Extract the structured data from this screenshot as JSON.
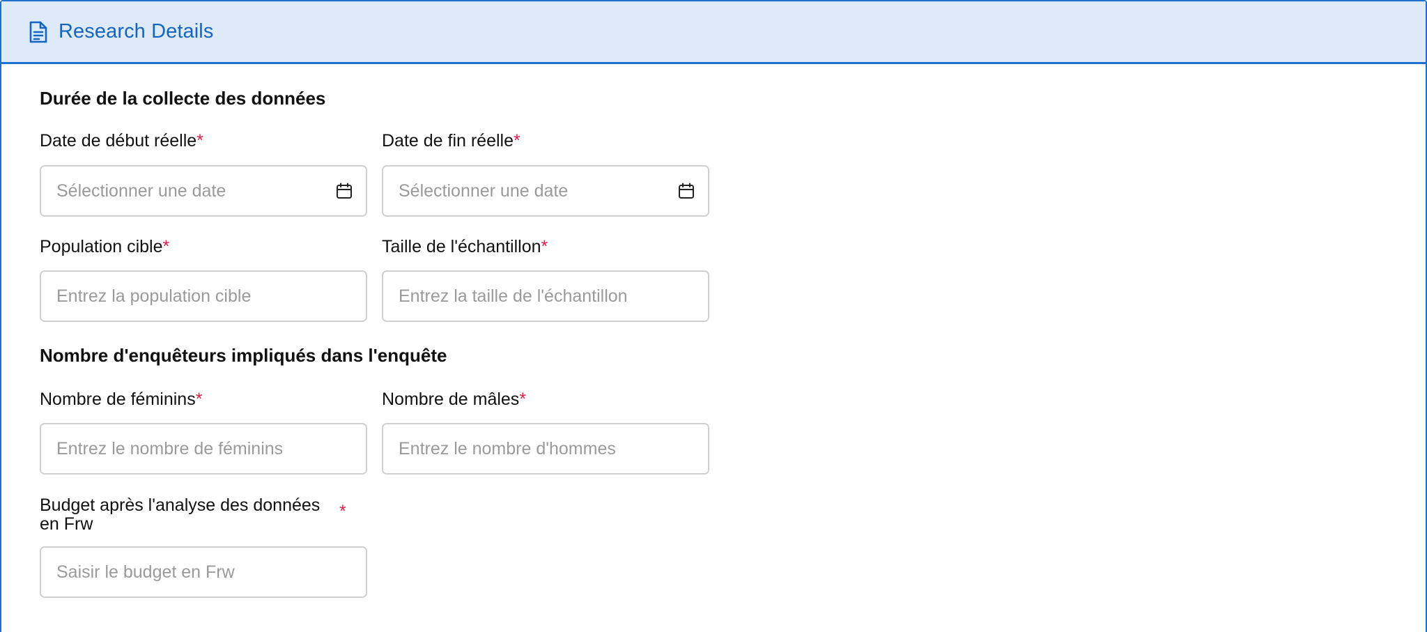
{
  "header": {
    "title": "Research Details",
    "icon": "document-icon",
    "accent_color": "#1f6fd1"
  },
  "sections": {
    "duration_title": "Durée de la collecte des données",
    "investigators_title": "Nombre d'enquêteurs impliqués dans l'enquête"
  },
  "fields": {
    "start_date": {
      "label": "Date de début réelle",
      "required": "*",
      "placeholder": "Sélectionner une date",
      "icon": "calendar-icon"
    },
    "end_date": {
      "label": "Date de fin réelle",
      "required": "*",
      "placeholder": "Sélectionner une date",
      "icon": "calendar-icon"
    },
    "target_population": {
      "label": "Population cible",
      "required": "*",
      "placeholder": "Entrez la population cible"
    },
    "sample_size": {
      "label": "Taille de l'échantillon",
      "required": "*",
      "placeholder": "Entrez la taille de l'échantillon"
    },
    "female_count": {
      "label": "Nombre de féminins",
      "required": "*",
      "placeholder": "Entrez le nombre de féminins"
    },
    "male_count": {
      "label": "Nombre de mâles",
      "required": "*",
      "placeholder": "Entrez le nombre d'hommes"
    },
    "budget": {
      "label": "Budget après l'analyse des données en Frw",
      "required": "*",
      "placeholder": "Saisir le budget en Frw"
    }
  },
  "colors": {
    "required_marker": "#e01e4a",
    "header_bg": "#dfeaf8",
    "input_border": "#d0d0d0"
  }
}
